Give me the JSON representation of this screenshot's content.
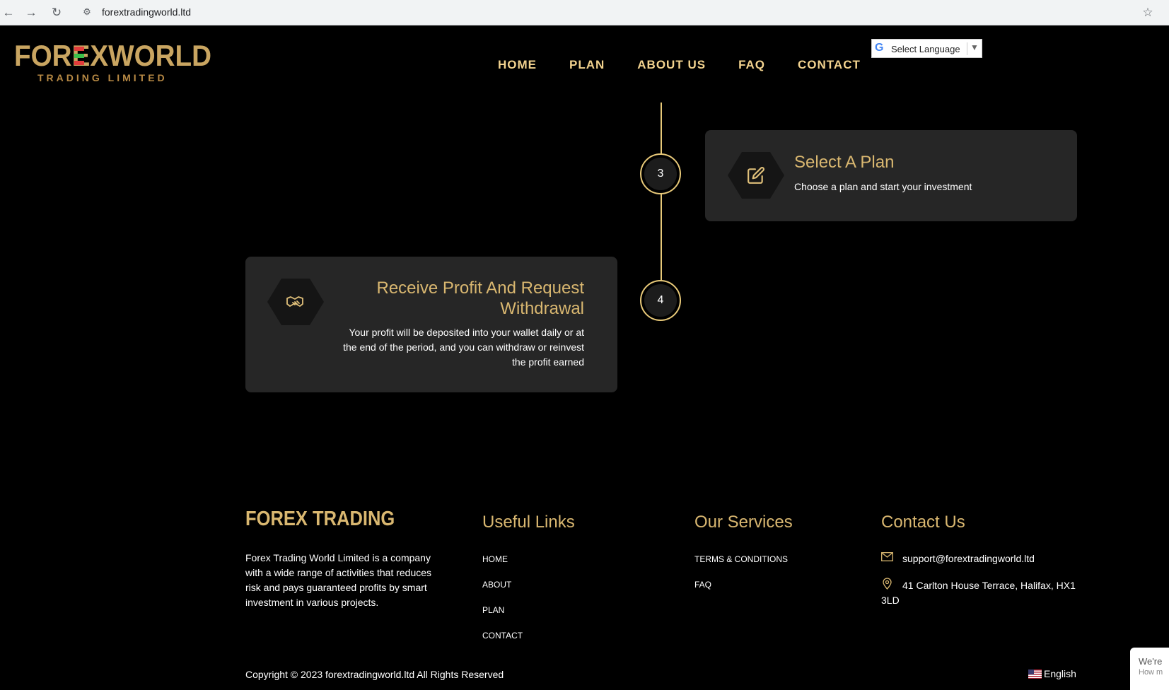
{
  "browser": {
    "back_icon": "←",
    "forward_icon": "→",
    "reload_icon": "↻",
    "site_info_icon": "⚙",
    "url": "forextradingworld.ltd",
    "star_icon": "☆"
  },
  "header": {
    "logo_main": "FOREXWORLD",
    "logo_sub": "TRADING LIMITED",
    "nav": [
      "HOME",
      "PLAN",
      "ABOUT US",
      "FAQ",
      "CONTACT"
    ],
    "language_select": "Select Language",
    "language_arrow": "▼"
  },
  "steps": [
    {
      "number": "3",
      "title": "Select A Plan",
      "description": "Choose a plan and start your investment",
      "icon": "edit-icon"
    },
    {
      "number": "4",
      "title": "Receive Profit And Request Withdrawal",
      "description": "Your profit will be deposited into your wallet daily or at the end of the period, and you can withdraw or reinvest the profit earned",
      "icon": "handshake-icon"
    }
  ],
  "footer": {
    "logo": "FOREX TRADING",
    "about": "Forex Trading World Limited is a company with a wide range of activities that reduces risk and pays guaranteed profits by smart investment in various projects.",
    "useful_links_title": "Useful Links",
    "useful_links": [
      "HOME",
      "ABOUT",
      "PLAN",
      "CONTACT"
    ],
    "services_title": "Our Services",
    "services": [
      "TERMS & CONDITIONS",
      "FAQ"
    ],
    "contact_title": "Contact Us",
    "email": "support@forextradingworld.ltd",
    "address": "41 Carlton House Terrace, Halifax, HX1 3LD",
    "copyright": "Copyright © 2023 forextradingworld.ltd All Rights Reserved",
    "language": "English"
  },
  "chat_widget": {
    "line1": "We're",
    "line2": "How m"
  },
  "colors": {
    "gold": "#d9b770",
    "nav_gold": "#f3d38f",
    "card_bg": "#262626",
    "page_bg": "#000000"
  }
}
